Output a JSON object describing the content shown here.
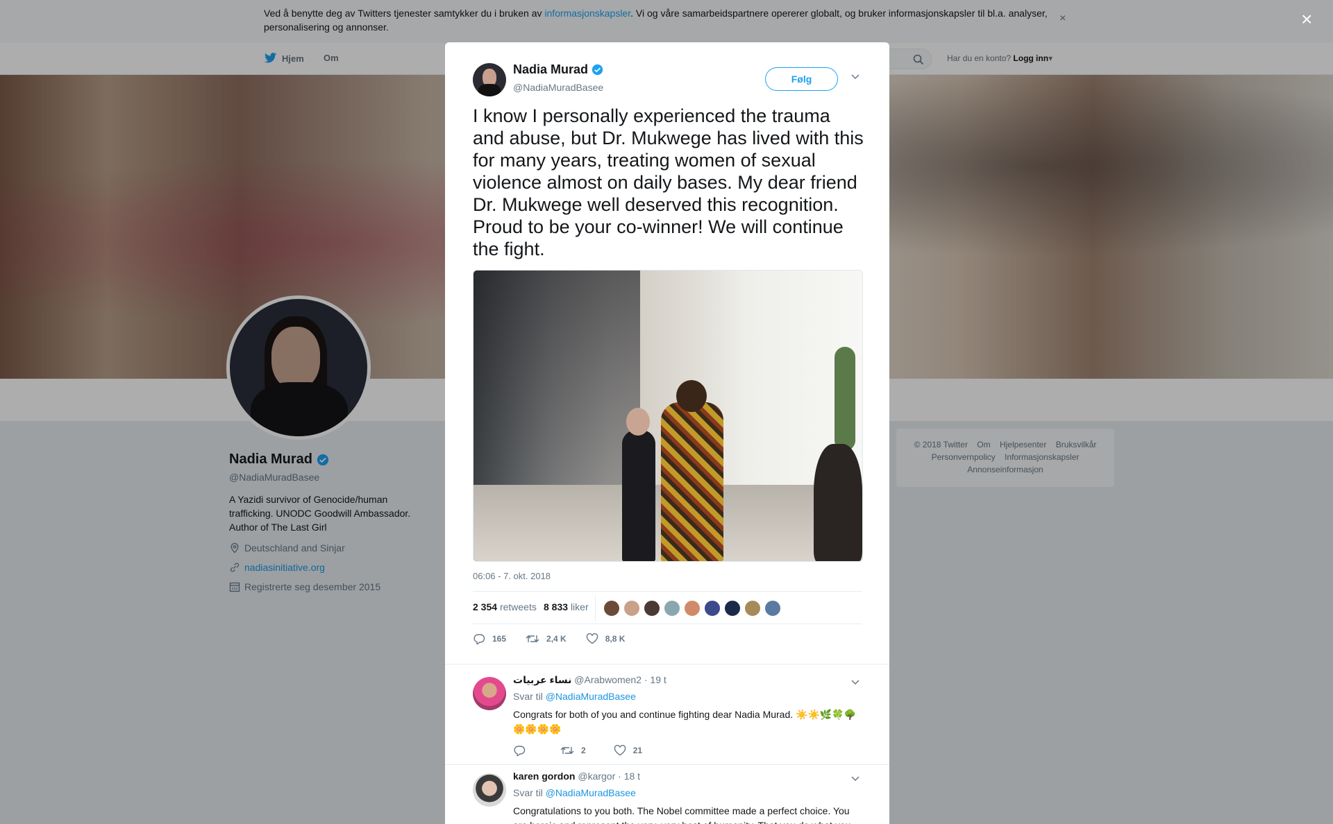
{
  "cookie_bar": {
    "text_before": "Ved å benytte deg av Twitters tjenester samtykker du i bruken av ",
    "link": "informasjonskapsler",
    "text_after": ". Vi og våre samarbeidspartnere opererer globalt, og bruker informasjonskapsler til bl.a. analyser, personalisering og annonser.",
    "close": "×"
  },
  "nav": {
    "home": "Hjem",
    "about": "Om",
    "have_account": "Har du en konto?",
    "login": "Logg inn"
  },
  "profile": {
    "name": "Nadia Murad",
    "handle": "@NadiaMuradBasee",
    "bio": "A Yazidi survivor of Genocide/human trafficking. UNODC Goodwill Ambassador. Author of The Last Girl",
    "location": "Deutschland and Sinjar",
    "website": "nadiasinitiative.org",
    "joined": "Registrerte seg desember 2015"
  },
  "footer": {
    "links": [
      "© 2018 Twitter",
      "Om",
      "Hjelpesenter",
      "Bruksvilkår",
      "Personvernpolicy",
      "Informasjonskapsler",
      "Annonseinformasjon"
    ]
  },
  "modal": {
    "close": "×",
    "author_name": "Nadia Murad",
    "author_handle": "@NadiaMuradBasee",
    "follow": "Følg",
    "text": "I know I personally experienced the trauma and abuse, but Dr. Mukwege has lived with this for many years, treating women of sexual violence almost on daily bases. My dear friend Dr. Mukwege well deserved this recognition. Proud to be your co-winner! We will continue the fight.",
    "time": "06:06 - 7. okt. 2018",
    "retweets_count": "2 354",
    "retweets_label": "retweets",
    "likes_count": "8 833",
    "likes_label": "liker",
    "actions": {
      "replies": "165",
      "retweets": "2,4 K",
      "likes": "8,8 K"
    }
  },
  "replies": [
    {
      "name": "ﻧﺴﺎﺀ ﻋﺮﺑﻴﺎﺕ",
      "handle": "@Arabwomen2",
      "time": "· 19 t",
      "to_label": "Svar til",
      "to_handle": "@NadiaMuradBasee",
      "text": "Congrats for both of you and continue fighting dear Nadia Murad. ☀️☀️🌿🍀🌳🌼🌼🌼🌼",
      "retweets": "2",
      "likes": "21"
    },
    {
      "name": "karen gordon",
      "handle": "@kargor",
      "time": "· 18 t",
      "to_label": "Svar til",
      "to_handle": "@NadiaMuradBasee",
      "text": "Congratulations to you both. The Nobel committee made a perfect choice.  You are heroic and represent the very, very best of humanity.  That you do what you"
    }
  ],
  "colors": {
    "accent": "#1da1f2",
    "verified": "#1da1f2",
    "link": "#1b95e0"
  },
  "liker_colors": [
    "#6b4a3a",
    "#c9a08a",
    "#4a3a34",
    "#8aa7b0",
    "#d08a6a",
    "#3b4a8a",
    "#1b2a4a",
    "#a68a5a",
    "#5a7aa0"
  ]
}
